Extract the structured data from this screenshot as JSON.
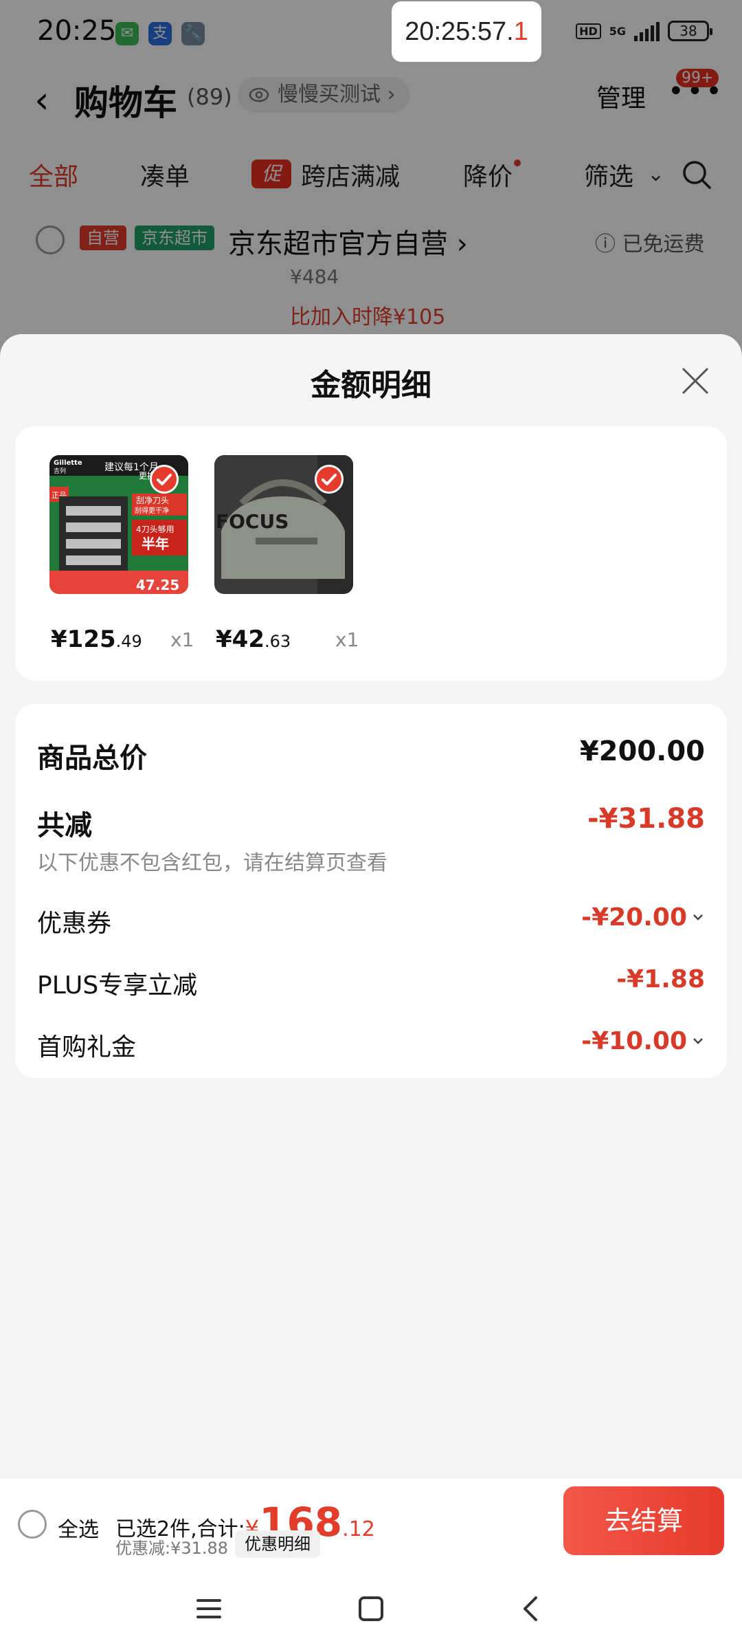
{
  "status_bar": {
    "time": "20:25",
    "overlay_clock_main": "20:25:57.",
    "overlay_clock_tenth": "1",
    "net_badge": "HD",
    "net_type": "5G",
    "battery": "38",
    "app_icons": [
      "wechat-icon",
      "alipay-icon",
      "tool-icon"
    ]
  },
  "header": {
    "title": "购物车",
    "count": "(89)",
    "test_label": "慢慢买测试",
    "manage": "管理",
    "badge": "99+"
  },
  "tabs": [
    {
      "label": "全部",
      "active": true
    },
    {
      "label": "凑单",
      "active": false
    },
    {
      "label": "跨店满减",
      "active": false,
      "tag": "促"
    },
    {
      "label": "降价",
      "active": false
    },
    {
      "label": "筛选",
      "active": false
    }
  ],
  "store": {
    "tag_self": "自营",
    "tag_jd": "京东超市",
    "name": "京东超市官方自营 ›",
    "shipping": "已免运费",
    "price": "¥484",
    "price_drop": "比加入时降¥105"
  },
  "sheet": {
    "title": "金额明细",
    "products": [
      {
        "price_int": "¥125",
        "price_dec": ".49",
        "qty": "x1",
        "thumb": "razor-product",
        "thumb_text": [
          "Gillette",
          "吉列",
          "建议每1个月",
          "更换",
          "刮净刀头",
          "刮得更干净",
          "4刀头够用",
          "半年",
          "正品",
          "47.25"
        ]
      },
      {
        "price_int": "¥42",
        "price_dec": ".63",
        "qty": "x1",
        "thumb": "gym-bag-product",
        "thumb_text": [
          "FOCUS"
        ]
      }
    ],
    "summary": {
      "total_label": "商品总价",
      "total_value": "¥200.00",
      "discount_label": "共减",
      "discount_value": "-¥31.88",
      "note": "以下优惠不包含红包，请在结算页查看",
      "items": [
        {
          "label": "优惠券",
          "value": "-¥20.00",
          "has_chevron": true
        },
        {
          "label": "PLUS专享立减",
          "value": "-¥1.88",
          "has_chevron": false
        },
        {
          "label": "首购礼金",
          "value": "-¥10.00",
          "has_chevron": true
        }
      ]
    }
  },
  "bottom_bar": {
    "select_all": "全选",
    "selected_prefix": "已选2件,合计:",
    "total_yen": "¥",
    "total_int": "168",
    "total_dec": ".12",
    "discount": "优惠减:¥31.88",
    "detail_button": "优惠明细",
    "checkout": "去结算"
  },
  "colors": {
    "accent_red": "#e23c2a",
    "checkout_red": "#e53a2c",
    "jd_green": "#1fa36b"
  },
  "nav_bar": [
    "menu-icon",
    "home-icon",
    "back-icon"
  ]
}
